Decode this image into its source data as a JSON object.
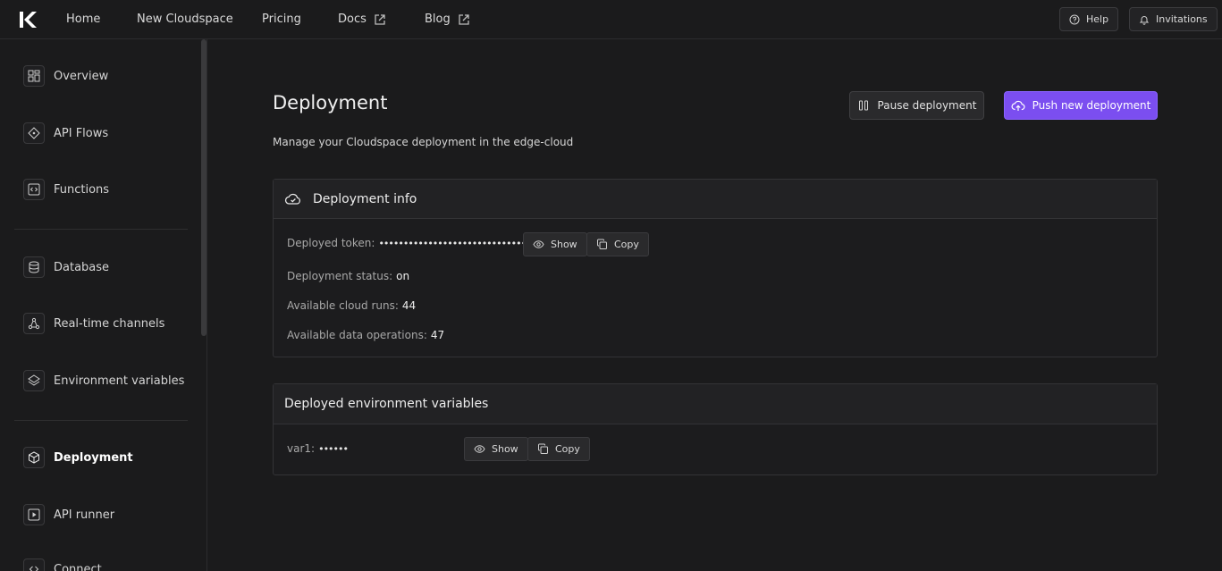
{
  "nav": {
    "home": "Home",
    "new_cloudspace": "New Cloudspace",
    "pricing": "Pricing",
    "docs": "Docs",
    "blog": "Blog",
    "help": "Help",
    "invitations": "Invitations"
  },
  "sidebar": {
    "items": [
      {
        "label": "Overview",
        "icon": "grid-icon"
      },
      {
        "label": "API Flows",
        "icon": "flows-icon"
      },
      {
        "label": "Functions",
        "icon": "code-icon"
      },
      {
        "label": "Database",
        "icon": "database-icon"
      },
      {
        "label": "Real-time channels",
        "icon": "channels-icon"
      },
      {
        "label": "Environment variables",
        "icon": "layers-icon"
      },
      {
        "label": "Deployment",
        "icon": "box-icon",
        "active": true
      },
      {
        "label": "API runner",
        "icon": "play-icon"
      },
      {
        "label": "Connect",
        "icon": "code-icon"
      }
    ]
  },
  "page": {
    "title": "Deployment",
    "subtitle": "Manage your Cloudspace deployment in the edge-cloud",
    "pause_label": "Pause deployment",
    "push_label": "Push new deployment",
    "accent": "#7b4ef0"
  },
  "info_card": {
    "title": "Deployment info",
    "token_label": "Deployed token:",
    "token_mask": "••••••••••••••••••••••••••••••••",
    "show_label": "Show",
    "copy_label": "Copy",
    "status_label": "Deployment status:",
    "status_value": "on",
    "cloud_runs_label": "Available cloud runs:",
    "cloud_runs_value": "44",
    "data_ops_label": "Available data operations:",
    "data_ops_value": "47"
  },
  "env_card": {
    "title": "Deployed environment variables",
    "var_label": "var1:",
    "var_mask": "••••••",
    "show_label": "Show",
    "copy_label": "Copy"
  }
}
